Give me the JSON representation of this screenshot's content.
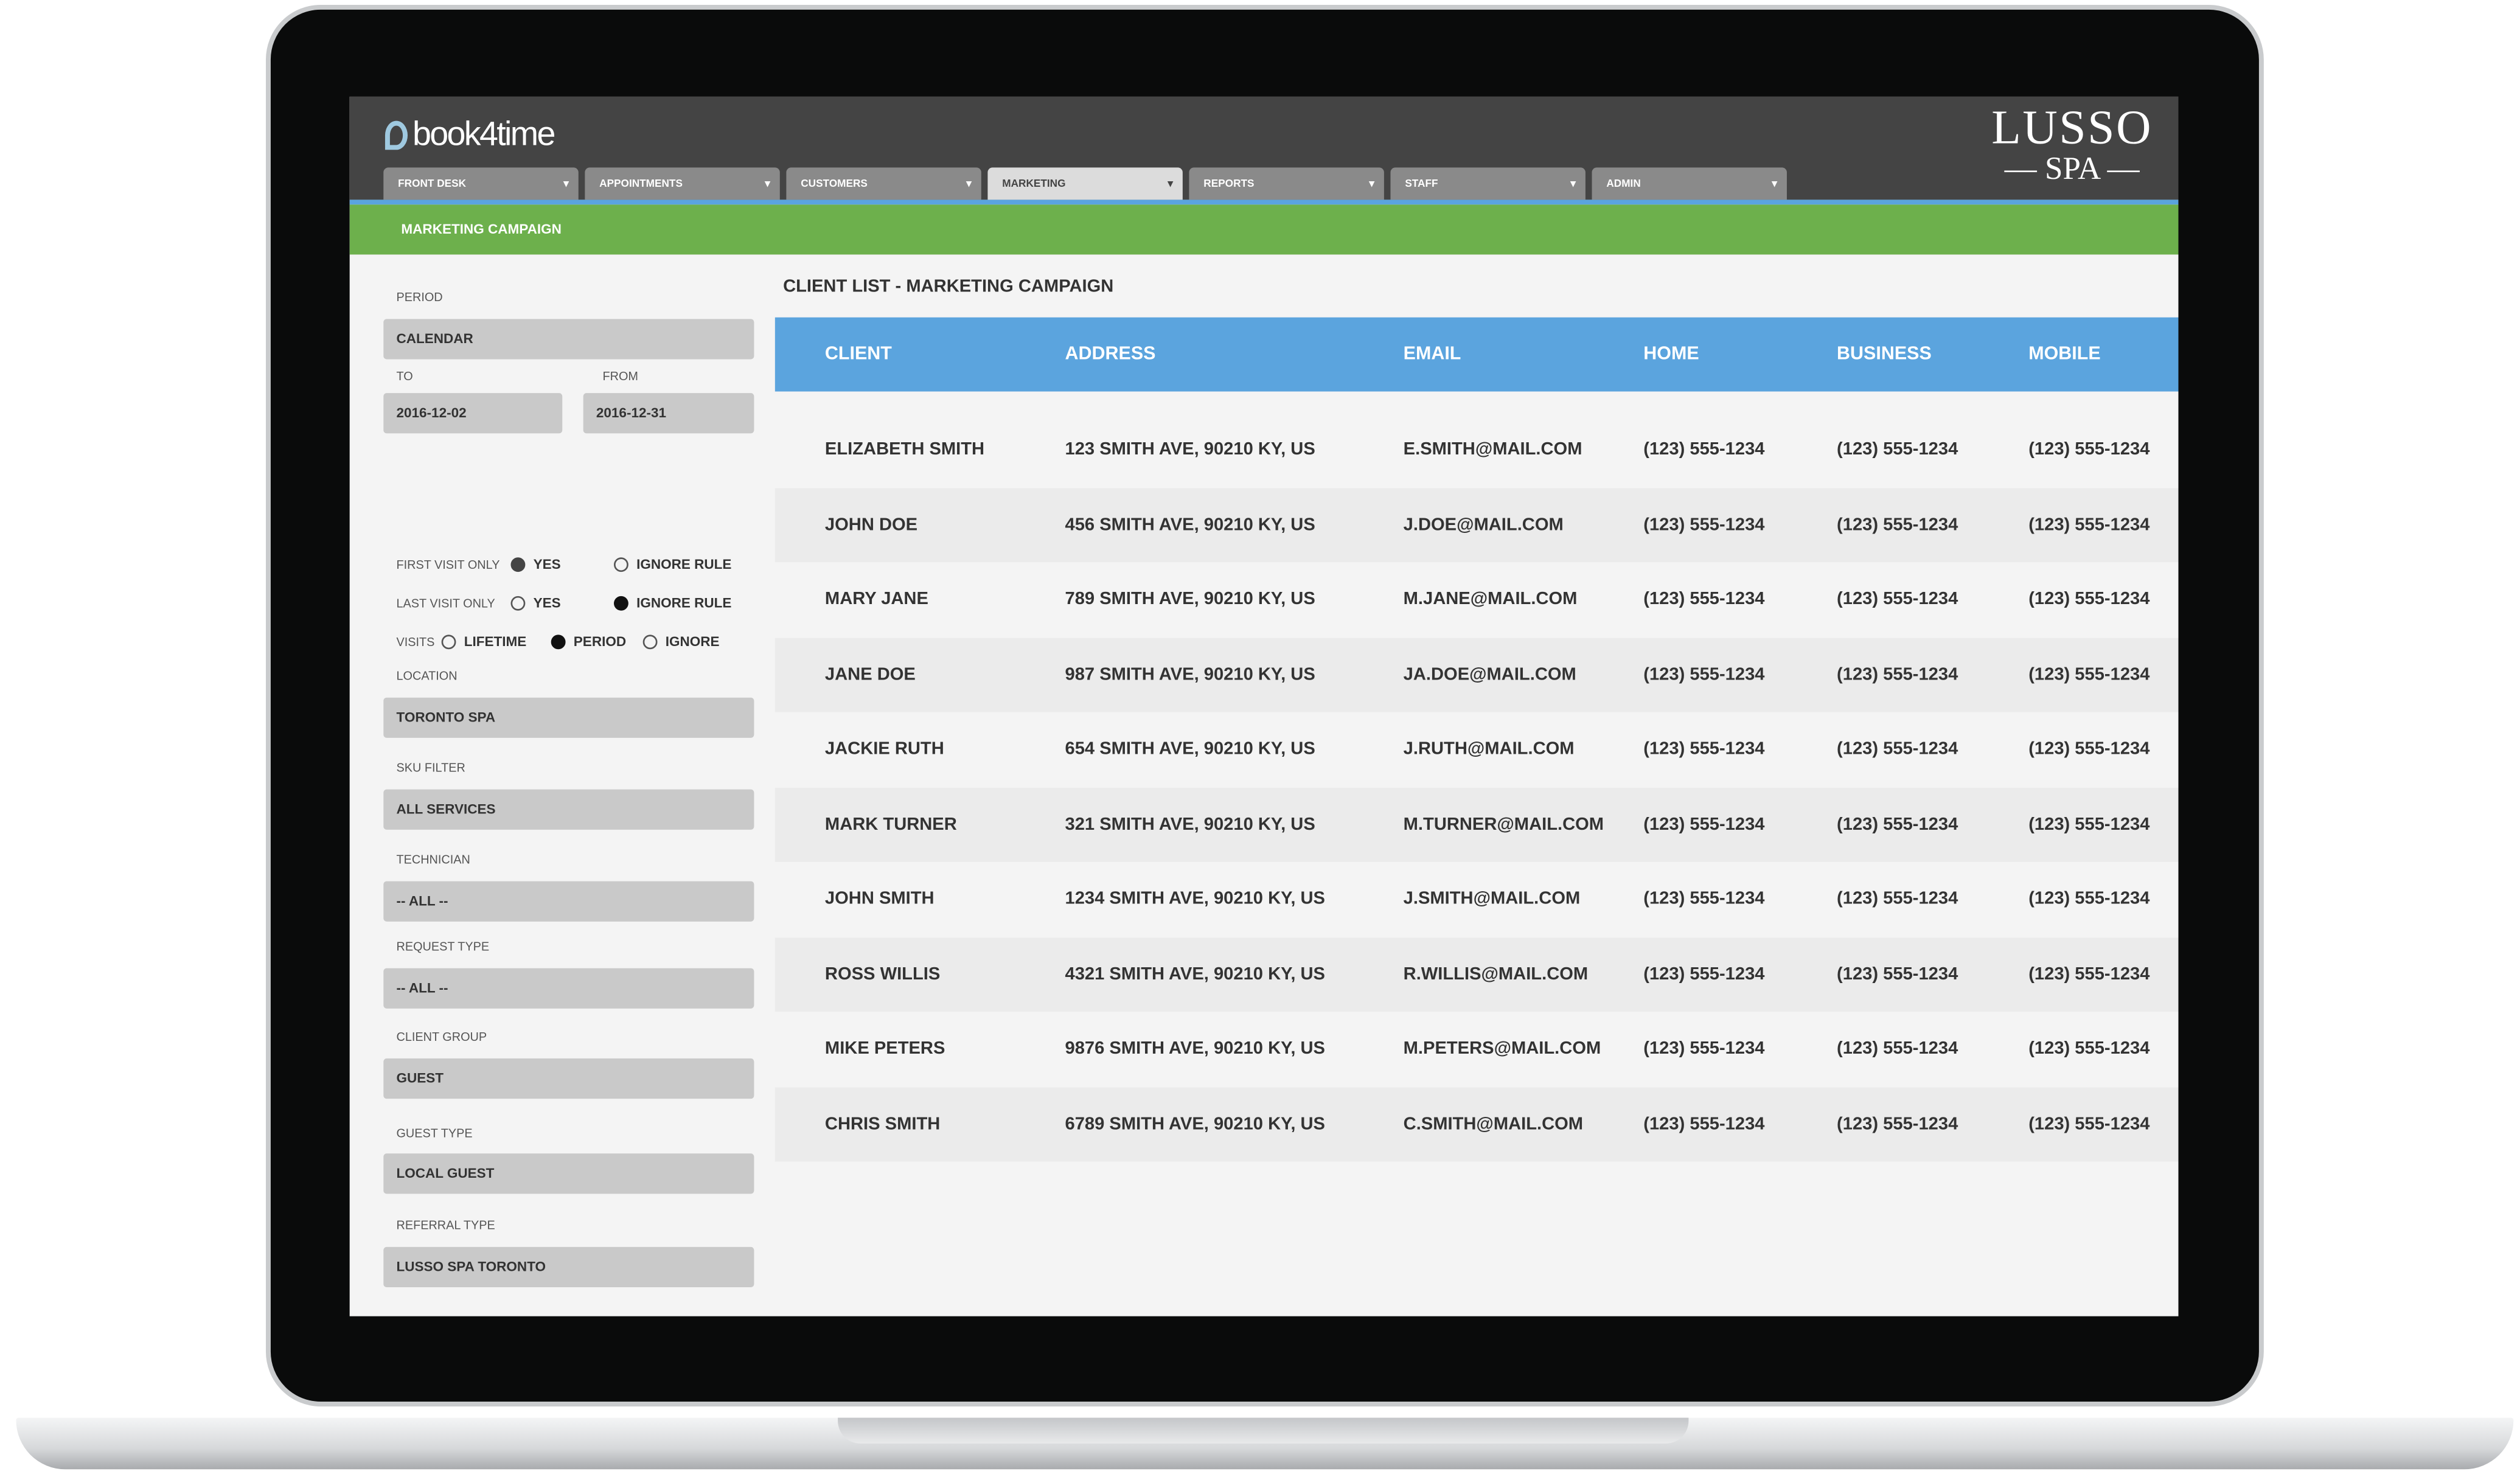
{
  "app": {
    "logo_text": "book4time",
    "brand": {
      "line1": "LUSSO",
      "line2": "— SPA —"
    },
    "nav_tabs": [
      {
        "label": "FRONT DESK",
        "active": false
      },
      {
        "label": "APPOINTMENTS",
        "active": false
      },
      {
        "label": "CUSTOMERS",
        "active": false
      },
      {
        "label": "MARKETING",
        "active": true
      },
      {
        "label": "REPORTS",
        "active": false
      },
      {
        "label": "STAFF",
        "active": false
      },
      {
        "label": "ADMIN",
        "active": false
      }
    ],
    "section_title": "MARKETING CAMPAIGN",
    "colors": {
      "header": "#444444",
      "accent_blue": "#5ba4de",
      "accent_green": "#6db04c"
    }
  },
  "filters": {
    "period": {
      "label": "PERIOD",
      "value": "CALENDAR"
    },
    "to": {
      "label": "TO",
      "value": "2016-12-02"
    },
    "from": {
      "label": "FROM",
      "value": "2016-12-31"
    },
    "first_visit": {
      "label": "FIRST VISIT ONLY",
      "opt1": "YES",
      "opt2": "IGNORE RULE",
      "selected": "YES"
    },
    "last_visit": {
      "label": "LAST VISIT ONLY",
      "opt1": "YES",
      "opt2": "IGNORE RULE",
      "selected": "IGNORE RULE"
    },
    "visits": {
      "label": "VISITS",
      "opt1": "LIFETIME",
      "opt2": "PERIOD",
      "opt3": "IGNORE",
      "selected": "PERIOD"
    },
    "location": {
      "label": "LOCATION",
      "value": "TORONTO SPA"
    },
    "sku": {
      "label": "SKU FILTER",
      "value": "ALL SERVICES"
    },
    "technician": {
      "label": "TECHNICIAN",
      "value": "-- ALL --"
    },
    "request_type": {
      "label": "REQUEST TYPE",
      "value": "-- ALL --"
    },
    "client_group": {
      "label": "CLIENT GROUP",
      "value": "GUEST"
    },
    "guest_type": {
      "label": "GUEST TYPE",
      "value": "LOCAL GUEST"
    },
    "referral_type": {
      "label": "REFERRAL TYPE",
      "value": "LUSSO SPA TORONTO"
    }
  },
  "table": {
    "title": "CLIENT LIST - MARKETING CAMPAIGN",
    "columns": [
      "CLIENT",
      "ADDRESS",
      "EMAIL",
      "HOME",
      "BUSINESS",
      "MOBILE"
    ],
    "rows": [
      [
        "ELIZABETH SMITH",
        "123 SMITH AVE, 90210 KY, US",
        "E.SMITH@MAIL.COM",
        "(123) 555-1234",
        "(123) 555-1234",
        "(123) 555-1234"
      ],
      [
        "JOHN DOE",
        "456 SMITH AVE, 90210 KY, US",
        "J.DOE@MAIL.COM",
        "(123) 555-1234",
        "(123) 555-1234",
        "(123) 555-1234"
      ],
      [
        "MARY JANE",
        "789 SMITH AVE, 90210 KY, US",
        "M.JANE@MAIL.COM",
        "(123) 555-1234",
        "(123) 555-1234",
        "(123) 555-1234"
      ],
      [
        "JANE DOE",
        "987 SMITH AVE, 90210 KY, US",
        "JA.DOE@MAIL.COM",
        "(123) 555-1234",
        "(123) 555-1234",
        "(123) 555-1234"
      ],
      [
        "JACKIE RUTH",
        "654 SMITH AVE, 90210 KY, US",
        "J.RUTH@MAIL.COM",
        "(123) 555-1234",
        "(123) 555-1234",
        "(123) 555-1234"
      ],
      [
        "MARK TURNER",
        "321 SMITH AVE, 90210 KY, US",
        "M.TURNER@MAIL.COM",
        "(123) 555-1234",
        "(123) 555-1234",
        "(123) 555-1234"
      ],
      [
        "JOHN SMITH",
        "1234 SMITH AVE, 90210 KY, US",
        "J.SMITH@MAIL.COM",
        "(123) 555-1234",
        "(123) 555-1234",
        "(123) 555-1234"
      ],
      [
        "ROSS WILLIS",
        "4321 SMITH AVE, 90210 KY, US",
        "R.WILLIS@MAIL.COM",
        "(123) 555-1234",
        "(123) 555-1234",
        "(123) 555-1234"
      ],
      [
        "MIKE PETERS",
        "9876 SMITH AVE, 90210 KY, US",
        "M.PETERS@MAIL.COM",
        "(123) 555-1234",
        "(123) 555-1234",
        "(123) 555-1234"
      ],
      [
        "CHRIS SMITH",
        "6789 SMITH AVE, 90210 KY, US",
        "C.SMITH@MAIL.COM",
        "(123) 555-1234",
        "(123) 555-1234",
        "(123) 555-1234"
      ]
    ]
  }
}
